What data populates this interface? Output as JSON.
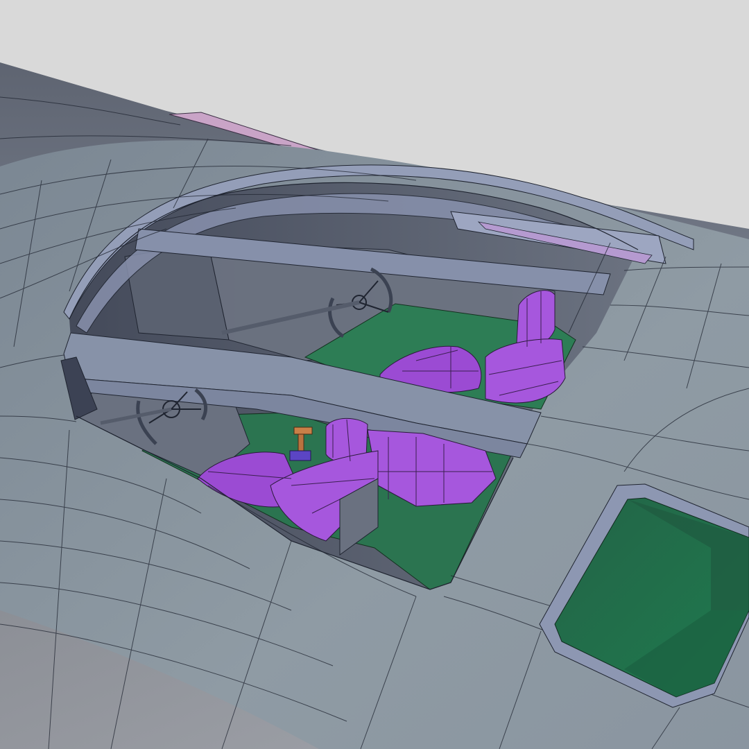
{
  "scene": {
    "subject": "cockpit-wireframe-render",
    "palette": {
      "background": "#d9d9d9",
      "hull": "#8c98a1",
      "hull_dark": "#626a76",
      "hull_top": "#717986",
      "frame": "#949eb8",
      "frame_dark": "#7d85a4",
      "floor": "#2d7d55",
      "window_glass": "#2a6d4d",
      "seat": "#a657dd",
      "seat_shadow": "#8a3fc3",
      "dash": "#616a78",
      "wire": "#1f2430",
      "stripe": "#c9a4c7",
      "lever": "#b9733f"
    }
  }
}
